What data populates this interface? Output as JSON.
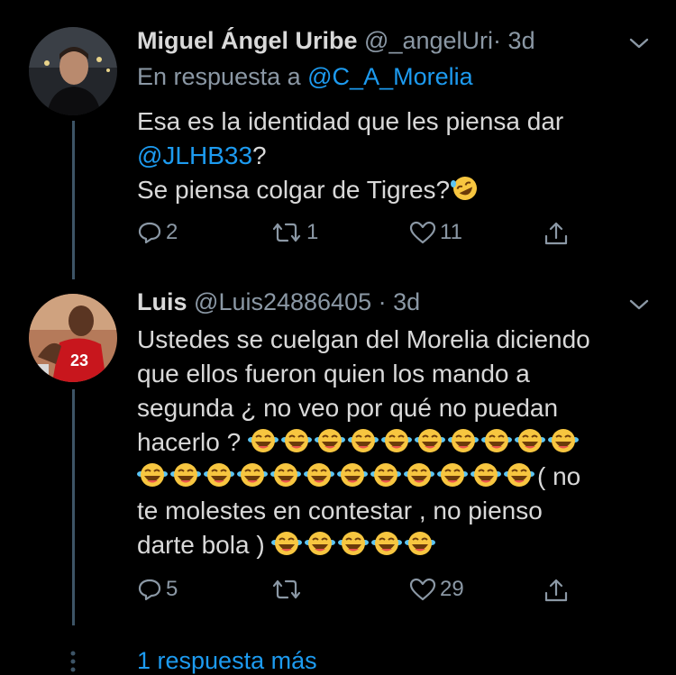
{
  "tweets": [
    {
      "name": "Miguel Ángel Uribe",
      "handle": "@_angelUri",
      "dot": "·",
      "time": "3d",
      "reply_prefix": "En respuesta a",
      "reply_to": "@C_A_Morelia",
      "text_line1": "Esa es la identidad que les piensa dar",
      "text_mention": "@JLHB33",
      "text_after_mention": "?",
      "text_line3": "Se piensa colgar de Tigres?",
      "emoji_icon": "rolling-on-floor-laughing-emoji",
      "replies": "2",
      "retweets": "1",
      "likes": "11"
    },
    {
      "name": "Luis",
      "handle": "@Luis24886405",
      "dot": "·",
      "time": "3d",
      "text_line1": "Ustedes se cuelgan del Morelia diciendo",
      "text_line2": "que ellos fueron quien los mando a",
      "text_line3": "segunda ¿ no veo por qué no puedan",
      "text_line4": "hacerlo ?",
      "text_line6_suffix": "( no",
      "text_line7": "te molestes en contestar , no pienso",
      "text_line8": "darte bola )",
      "emoji_icon": "face-with-tears-of-joy-emoji",
      "replies": "5",
      "retweets": "",
      "likes": "29"
    }
  ],
  "more_replies": "1 respuesta más",
  "colors": {
    "background": "#000000",
    "text": "#d9d9d9",
    "muted": "#8b98a5",
    "link": "#1d9bf0",
    "thread_line": "#3d5466"
  }
}
